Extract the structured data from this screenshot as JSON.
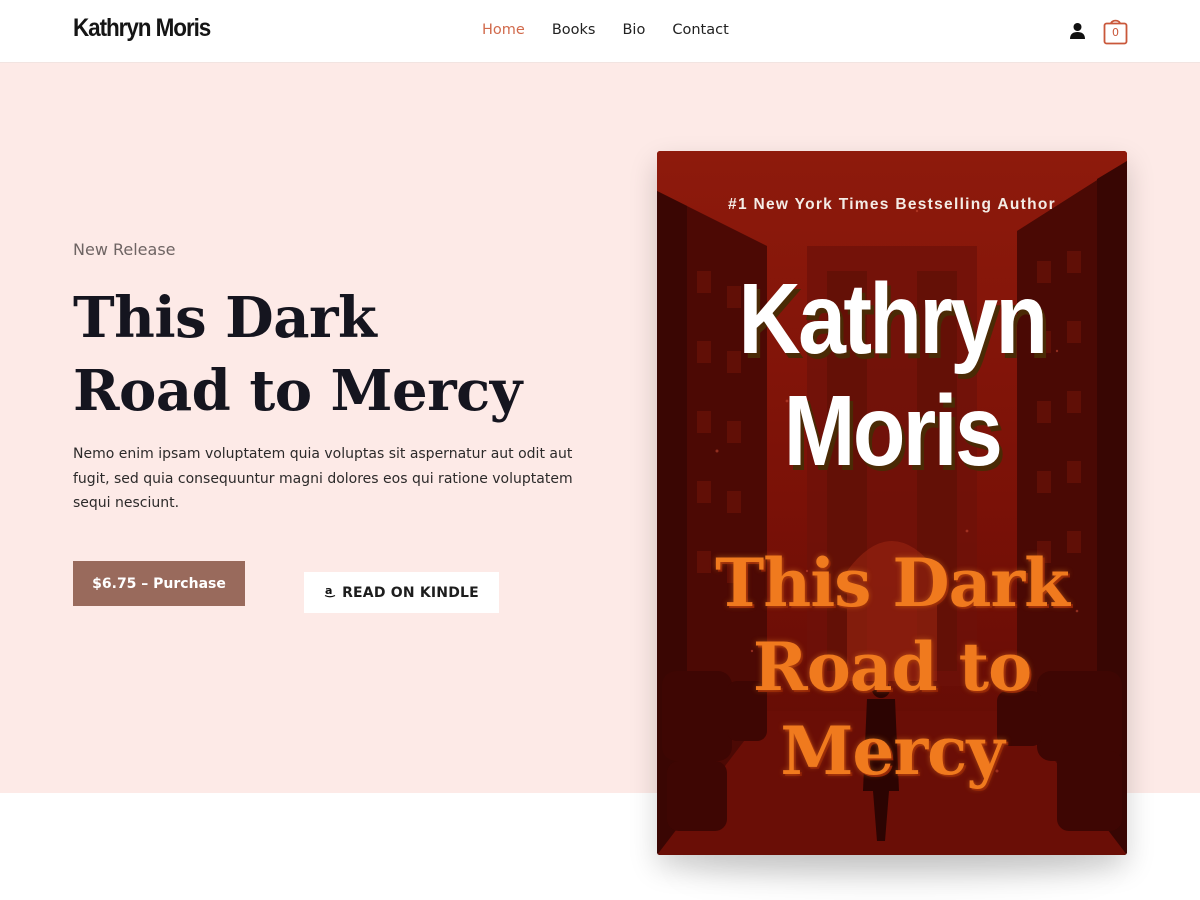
{
  "header": {
    "logo": "Kathryn Moris",
    "nav": [
      {
        "label": "Home",
        "active": true
      },
      {
        "label": "Books",
        "active": false
      },
      {
        "label": "Bio",
        "active": false
      },
      {
        "label": "Contact",
        "active": false
      }
    ],
    "account_icon": "user-icon",
    "cart_icon": "shopping-bag-icon",
    "cart_count": "0"
  },
  "hero": {
    "eyebrow": "New Release",
    "title_line1": "This Dark",
    "title_line2": "Road to Mercy",
    "description": "Nemo enim ipsam voluptatem quia voluptas sit aspernatur aut odit aut fugit, sed quia consequuntur magni dolores eos qui ratione voluptatem sequi nesciunt.",
    "purchase_label": "$6.75 – Purchase",
    "kindle_label": "READ ON KINDLE",
    "kindle_icon": "amazon-icon"
  },
  "cover": {
    "tagline": "#1 New York Times Bestselling Author",
    "author_line1": "Kathryn",
    "author_line2": "Moris",
    "title_line1": "This Dark",
    "title_line2": "Road to",
    "title_line3": "Mercy"
  },
  "colors": {
    "accent": "#d16a4c",
    "hero_bg": "#fdeae7",
    "purchase_bg": "#996a5c",
    "cover_red": "#7d0f06",
    "cover_title_orange": "#f07a1e"
  }
}
